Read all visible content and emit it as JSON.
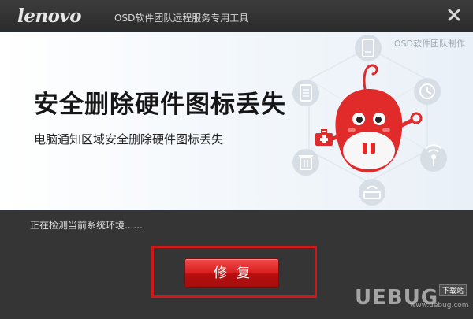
{
  "titlebar": {
    "logo": "lenovo",
    "title": "OSD软件团队远程服务专用工具"
  },
  "banner": {
    "credit": "OSD软件团队制作",
    "headline": "安全删除硬件图标丢失",
    "subline": "电脑通知区域安全删除硬件图标丢失"
  },
  "body": {
    "status": "正在检测当前系统环境......",
    "repair_label": "修复"
  },
  "watermark": {
    "text": "UEBUG",
    "small": "www.uebug.com",
    "badge": "下载站"
  },
  "colors": {
    "accent_red": "#d11818",
    "mascot_red": "#e12a2a",
    "dark_bg": "#353535"
  }
}
